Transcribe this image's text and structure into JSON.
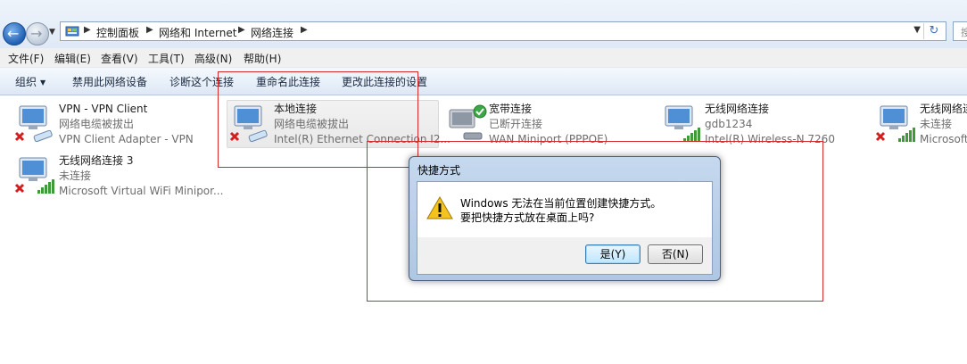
{
  "address": {
    "crumbs": [
      "控制面板",
      "网络和 Internet",
      "网络连接"
    ],
    "search_placeholder": "搜"
  },
  "menu": [
    "文件(F)",
    "编辑(E)",
    "查看(V)",
    "工具(T)",
    "高级(N)",
    "帮助(H)"
  ],
  "commands": {
    "organize": "组织",
    "disable": "禁用此网络设备",
    "diagnose": "诊断这个连接",
    "rename": "重命名此连接",
    "change": "更改此连接的设置"
  },
  "connections": [
    {
      "name": "VPN - VPN Client",
      "status": "网络电缆被拔出",
      "device": "VPN Client Adapter - VPN"
    },
    {
      "name": "本地连接",
      "status": "网络电缆被拔出",
      "device": "Intel(R) Ethernet Connection I2..."
    },
    {
      "name": "宽带连接",
      "status": "已断开连接",
      "device": "WAN Miniport (PPPOE)"
    },
    {
      "name": "无线网络连接",
      "status": "gdb1234",
      "device": "Intel(R) Wireless-N 7260"
    },
    {
      "name": "无线网络连",
      "status": "未连接",
      "device": "Microsoft"
    },
    {
      "name": "无线网络连接 3",
      "status": "未连接",
      "device": "Microsoft Virtual WiFi Minipor..."
    }
  ],
  "dialog": {
    "title": "快捷方式",
    "line1": "Windows 无法在当前位置创建快捷方式。",
    "line2": "要把快捷方式放在桌面上吗?",
    "yes": "是(Y)",
    "no": "否(N)"
  },
  "colors": {
    "accent": "#3c7fb1",
    "annotation_red": "#d42a2a",
    "error_red": "#d22020"
  }
}
